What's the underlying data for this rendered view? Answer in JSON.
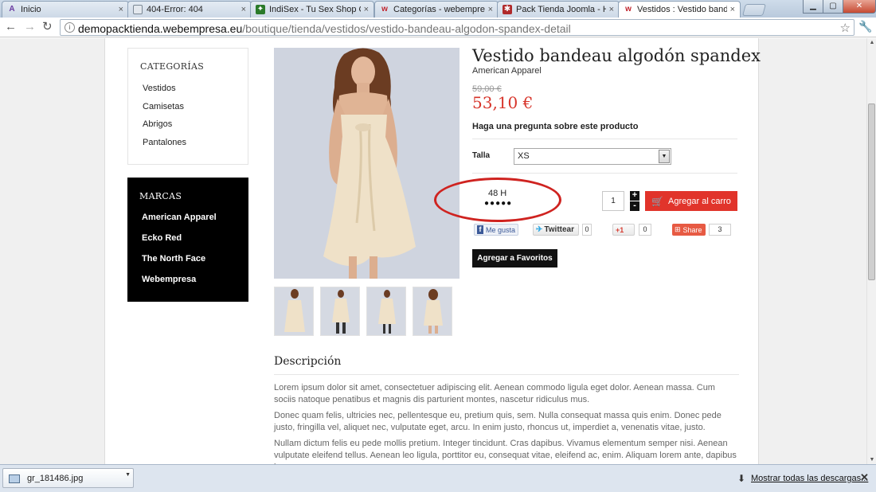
{
  "browser": {
    "tabs": [
      {
        "label": "Inicio",
        "favicon": "pin-a-icon"
      },
      {
        "label": "404-Error: 404",
        "favicon": "globe-icon"
      },
      {
        "label": "IndiSex - Tu Sex Shop Onli",
        "favicon": "indisex-icon"
      },
      {
        "label": "Categorías - webempresa j",
        "favicon": "webempresa-icon"
      },
      {
        "label": "Pack Tienda Joomla - Host",
        "favicon": "joomla-icon"
      },
      {
        "label": "Vestidos : Vestido bandeau",
        "favicon": "webempresa-icon",
        "active": true
      }
    ],
    "tab_close_glyph": "×",
    "url_host": "demopacktienda.webempresa.eu",
    "url_path": "/boutique/tienda/vestidos/vestido-bandeau-algodon-spandex-detail"
  },
  "sidebar": {
    "categories_title": "CATEGORÍAS",
    "categories": [
      "Vestidos",
      "Camisetas",
      "Abrigos",
      "Pantalones"
    ],
    "brands_title": "MARCAS",
    "brands": [
      "American Apparel",
      "Ecko Red",
      "The North Face",
      "Webempresa"
    ]
  },
  "product": {
    "title": "Vestido bandeau algodón spandex",
    "brand": "American Apparel",
    "old_price": "59,00 €",
    "price": "53,10 €",
    "ask_question": "Haga una pregunta sobre este producto",
    "size_label": "Talla",
    "size_value": "XS",
    "stock_hours": "48 H",
    "stock_dots": "●●●●●",
    "quantity": "1",
    "qty_plus": "+",
    "qty_minus": "-",
    "add_to_cart": "Agregar al carro",
    "add_to_favorites": "Agregar a Favoritos"
  },
  "social": {
    "fb_label": "Me gusta",
    "twitter_label": "Twittear",
    "twitter_count": "0",
    "gplus_label": "+1",
    "gplus_count": "0",
    "share_label": "Share",
    "share_count": "3"
  },
  "description": {
    "title": "Descripción",
    "paragraphs": [
      "Lorem ipsum dolor sit amet, consectetuer adipiscing elit. Aenean commodo ligula eget dolor. Aenean massa. Cum sociis natoque penatibus et magnis dis parturient montes, nascetur ridiculus mus.",
      "Donec quam felis, ultricies nec, pellentesque eu, pretium quis, sem. Nulla consequat massa quis enim. Donec pede justo, fringilla vel, aliquet nec, vulputate eget, arcu. In enim justo, rhoncus ut, imperdiet a, venenatis vitae, justo.",
      "Nullam dictum felis eu pede mollis pretium. Integer tincidunt. Cras dapibus. Vivamus elementum semper nisi. Aenean vulputate eleifend tellus. Aenean leo ligula, porttitor eu, consequat vitae, eleifend ac, enim. Aliquam lorem ante, dapibus in,"
    ]
  },
  "downloads": {
    "file_name": "gr_181486.jpg",
    "show_all": "Mostrar todas las descargas..."
  },
  "colors": {
    "accent_red": "#e1342b",
    "price_red": "#d7342a",
    "annotation_red": "#cf2320"
  }
}
